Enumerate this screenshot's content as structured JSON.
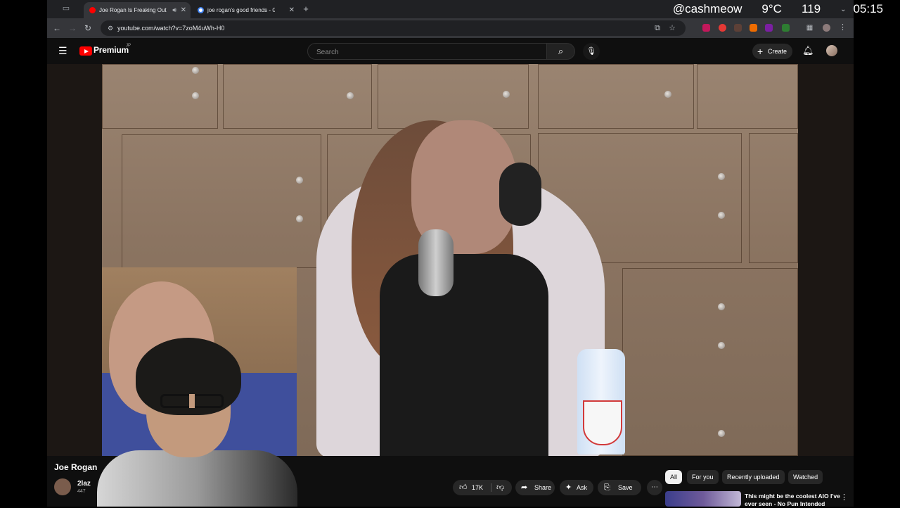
{
  "browser": {
    "tabs": [
      {
        "title": "Joe Rogan Is Freaking Out",
        "active": true,
        "audible": true
      },
      {
        "title": "joe rogan's good friends - Go",
        "active": false,
        "audible": false
      }
    ],
    "url": "youtube.com/watch?v=7zoM4uWh-H0"
  },
  "system": {
    "handle": "@cashmeow",
    "temperature": "9°C",
    "number": "119",
    "time": "05:15"
  },
  "youtube": {
    "brand": "Premium",
    "region": "JP",
    "search_placeholder": "Search",
    "create_label": "Create"
  },
  "video": {
    "title": "Joe Rogan",
    "channel_name": "2laz",
    "subscribers": "447",
    "likes": "17K",
    "share_label": "Share",
    "ask_label": "Ask",
    "save_label": "Save"
  },
  "sidebar": {
    "chips": [
      "All",
      "For you",
      "Recently uploaded",
      "Watched"
    ],
    "selected_chip": "All",
    "recommendation_title": "This might be the coolest AIO I've ever seen - No Pun Intended"
  },
  "colors": {
    "youtube_red": "#ff0000",
    "page_bg": "#0f0f0f",
    "chip_selected": "#f1f1f1"
  }
}
